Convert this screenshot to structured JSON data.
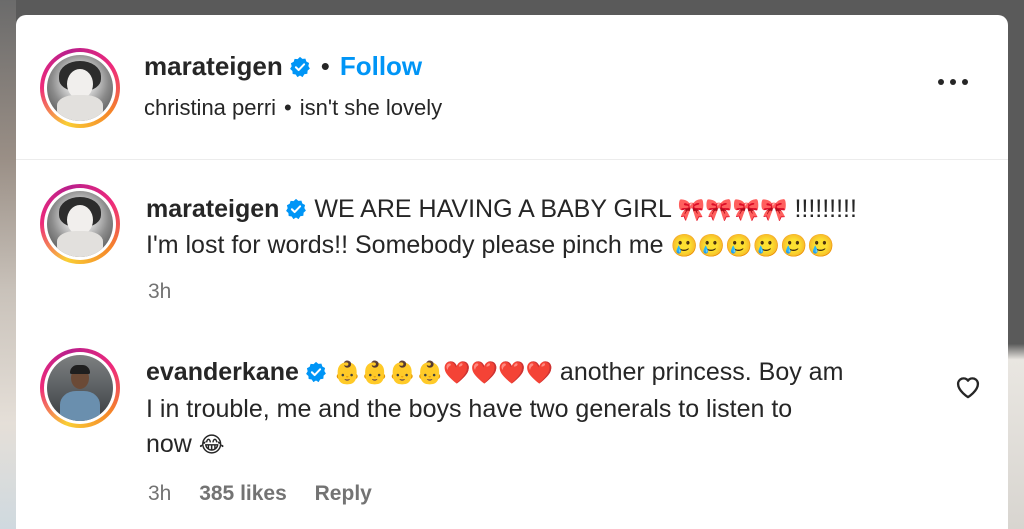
{
  "post": {
    "author": "marateigen",
    "follow_label": "Follow",
    "separator": "•",
    "audio_artist": "christina perri",
    "audio_title": "isn't she lovely"
  },
  "caption": {
    "author": "marateigen",
    "line1_text": "WE ARE HAVING A BABY GIRL",
    "line1_emoji": "🎀🎀🎀🎀",
    "line1_suffix": "!!!!!!!!!",
    "line2_text": "I'm lost for words!! Somebody please pinch me",
    "line2_emoji": "🥲🥲🥲🥲🥲🥲",
    "time": "3h"
  },
  "comment": {
    "author": "evanderkane",
    "emoji": "👶👶👶👶❤️❤️❤️❤️",
    "line1_text": "another princess. Boy am",
    "line2_text": "I in trouble, me and the boys have two generals to listen to",
    "line3_text": "now",
    "line3_emoji": "😂",
    "time": "3h",
    "likes": "385 likes",
    "reply_label": "Reply"
  },
  "icons": {
    "verified": "verified-badge-icon",
    "more": "more-options-icon",
    "like": "heart-outline-icon"
  },
  "colors": {
    "link_blue": "#0095f6",
    "verified_blue": "#0095f6",
    "text": "#262626",
    "secondary_text": "#737373"
  }
}
